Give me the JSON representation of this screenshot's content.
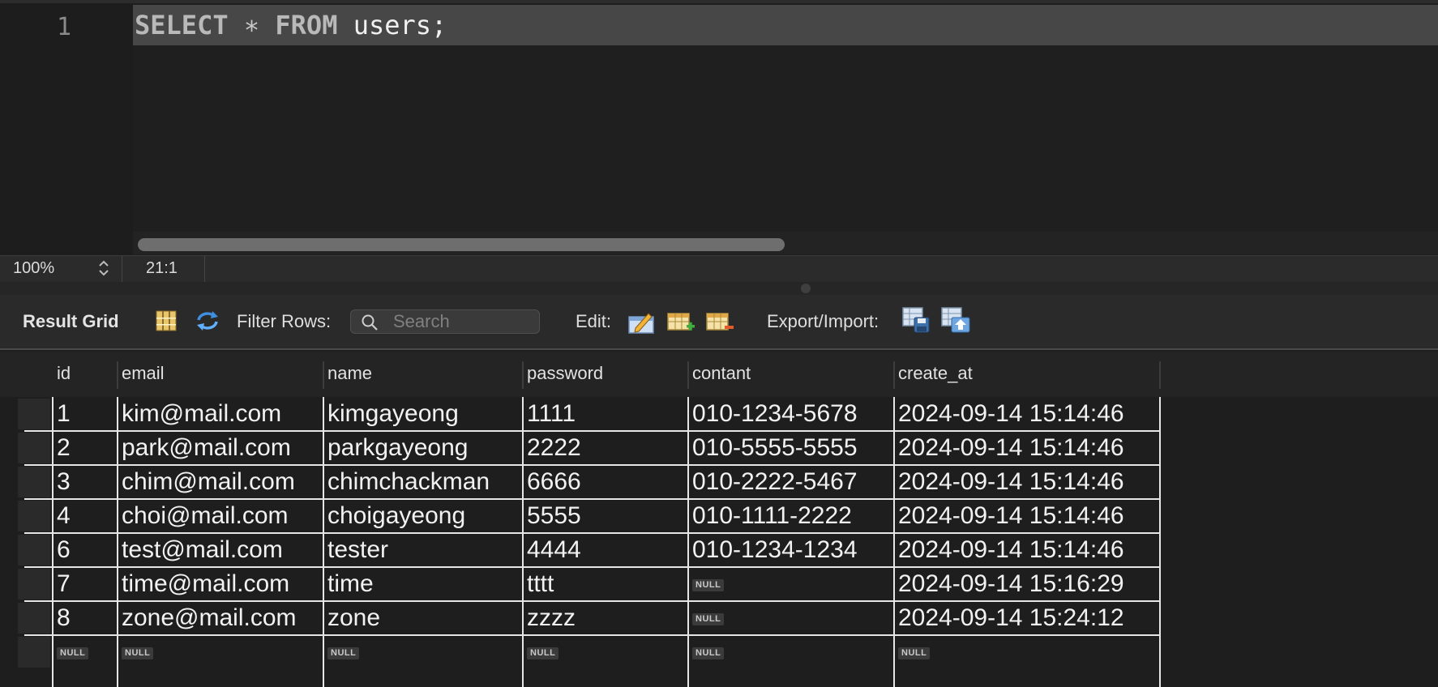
{
  "editor": {
    "line_number": "1",
    "query": {
      "select": "SELECT",
      "star": "∗",
      "from": "FROM",
      "table": "users;"
    }
  },
  "status": {
    "zoom": "100%",
    "cursor": "21:1"
  },
  "toolbar": {
    "result_grid_label": "Result Grid",
    "filter_rows_label": "Filter Rows:",
    "search_placeholder": "Search",
    "edit_label": "Edit:",
    "export_import_label": "Export/Import:"
  },
  "grid": {
    "columns": [
      "id",
      "email",
      "name",
      "password",
      "contant",
      "create_at"
    ],
    "rows": [
      [
        "1",
        "kim@mail.com",
        "kimgayeong",
        "1111",
        "010-1234-5678",
        "2024-09-14 15:14:46"
      ],
      [
        "2",
        "park@mail.com",
        "parkgayeong",
        "2222",
        "010-5555-5555",
        "2024-09-14 15:14:46"
      ],
      [
        "3",
        "chim@mail.com",
        "chimchackman",
        "6666",
        "010-2222-5467",
        "2024-09-14 15:14:46"
      ],
      [
        "4",
        "choi@mail.com",
        "choigayeong",
        "5555",
        "010-1111-2222",
        "2024-09-14 15:14:46"
      ],
      [
        "6",
        "test@mail.com",
        "tester",
        "4444",
        "010-1234-1234",
        "2024-09-14 15:14:46"
      ],
      [
        "7",
        "time@mail.com",
        "time",
        "tttt",
        "NULL",
        "2024-09-14 15:16:29"
      ],
      [
        "8",
        "zone@mail.com",
        "zone",
        "zzzz",
        "NULL",
        "2024-09-14 15:24:12"
      ],
      [
        "NULL",
        "NULL",
        "NULL",
        "NULL",
        "NULL",
        "NULL"
      ]
    ]
  }
}
